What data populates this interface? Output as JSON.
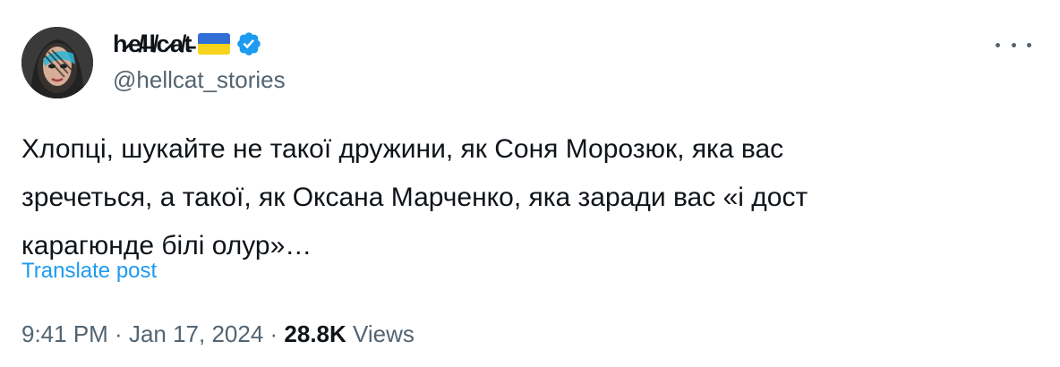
{
  "author": {
    "display_name": "h̷e̸l̶l̸c̷a̸t̵",
    "handle": "@hellcat_stories",
    "flag": "ukraine-flag",
    "verified": true
  },
  "tweet": {
    "lines": [
      "Хлопці, шукайте не такої дружини, як Соня Морозюк, яка вас",
      "зречеться, а такої, як Оксана Марченко, яка заради вас «і дост",
      "карагюнде білі олур»…"
    ],
    "translate_label": "Translate post"
  },
  "meta": {
    "time": "9:41 PM",
    "separator": " · ",
    "date": "Jan 17, 2024",
    "views_count": "28.8K",
    "views_label": "Views"
  },
  "colors": {
    "accent": "#1d9bf0",
    "secondary_text": "#536471",
    "primary_text": "#0f1419"
  }
}
